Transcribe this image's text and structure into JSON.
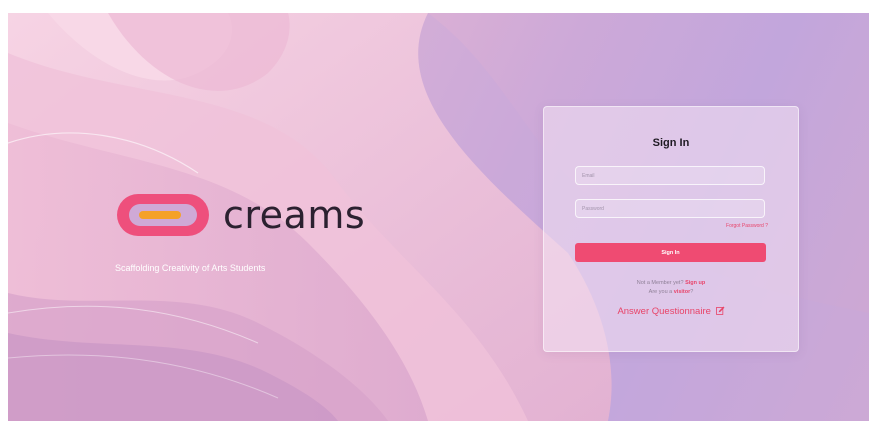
{
  "brand": {
    "name": "creams",
    "tagline": "Scaffolding Creativity of Arts Students",
    "logo_icon": "pill-logo-icon"
  },
  "signin": {
    "title": "Sign In",
    "email_placeholder": "Email",
    "password_placeholder": "Password",
    "forgot_label": "Forgot Password ?",
    "submit_label": "Sign In",
    "not_member_text": "Not a Member yet?",
    "signup_label": "Sign up",
    "visitor_prefix": "Are you a",
    "visitor_label": "visitor",
    "visitor_suffix": "?",
    "questionnaire_label": "Answer Questionnaire",
    "questionnaire_icon": "edit-icon"
  },
  "colors": {
    "accent": "#ef4b72",
    "logo_ring": "#ee4f7c",
    "logo_bar": "#f5a128"
  }
}
